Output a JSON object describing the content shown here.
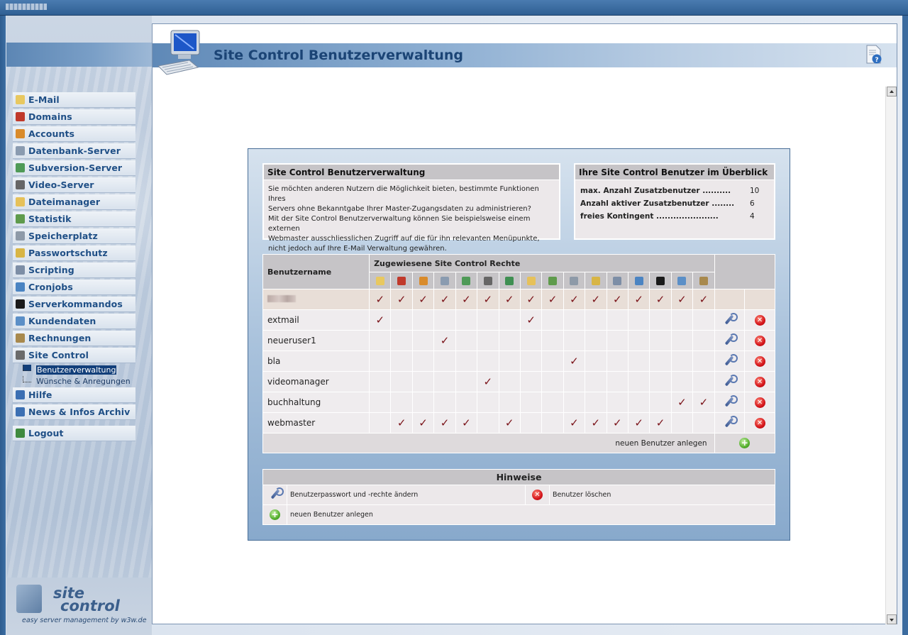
{
  "sidebar": {
    "items": [
      {
        "label": "E-Mail",
        "icon": "mail-icon",
        "color": "#e8c860"
      },
      {
        "label": "Domains",
        "icon": "domains-icon",
        "color": "#c0392b"
      },
      {
        "label": "Accounts",
        "icon": "accounts-icon",
        "color": "#d98b2b"
      },
      {
        "label": "Datenbank-Server",
        "icon": "database-icon",
        "color": "#8a9bb0"
      },
      {
        "label": "Subversion-Server",
        "icon": "subversion-icon",
        "color": "#4f9a57"
      },
      {
        "label": "Video-Server",
        "icon": "video-icon",
        "color": "#666666"
      },
      {
        "label": "Dateimanager",
        "icon": "folder-icon",
        "color": "#e6c15a"
      },
      {
        "label": "Statistik",
        "icon": "statistics-icon",
        "color": "#5f9b4c"
      },
      {
        "label": "Speicherplatz",
        "icon": "disk-icon",
        "color": "#8e9aa8"
      },
      {
        "label": "Passwortschutz",
        "icon": "lock-icon",
        "color": "#d8b545"
      },
      {
        "label": "Scripting",
        "icon": "script-icon",
        "color": "#7d8ea6"
      },
      {
        "label": "Cronjobs",
        "icon": "clock-icon",
        "color": "#4b84c2"
      },
      {
        "label": "Serverkommandos",
        "icon": "terminal-icon",
        "color": "#1a1a1a"
      },
      {
        "label": "Kundendaten",
        "icon": "customer-icon",
        "color": "#5b8fc7"
      },
      {
        "label": "Rechnungen",
        "icon": "invoice-icon",
        "color": "#a8894d"
      },
      {
        "label": "Site Control",
        "icon": "site-control-icon",
        "color": "#6b6b6b"
      }
    ],
    "subitems": [
      {
        "label": "Benutzerverwaltung",
        "active": true
      },
      {
        "label": "Wünsche & Anregungen",
        "active": false
      }
    ],
    "items_after": [
      {
        "label": "Hilfe",
        "icon": "help-icon",
        "color": "#3b6fb3"
      },
      {
        "label": "News & Infos Archiv",
        "icon": "info-icon",
        "color": "#3b6fb3"
      }
    ],
    "logout": {
      "label": "Logout",
      "icon": "logout-icon",
      "color": "#3f8a3f"
    },
    "brand": {
      "line1": "site",
      "line2": "control",
      "tagline": "easy server management by w3w.de"
    }
  },
  "header": {
    "title": "Site Control Benutzerverwaltung"
  },
  "info": {
    "title": "Site Control Benutzerverwaltung",
    "lines": [
      "Sie möchten anderen Nutzern die Möglichkeit bieten, bestimmte Funktionen Ihres",
      "Servers ohne Bekanntgabe Ihrer Master-Zugangsdaten zu administrieren?",
      "Mit der Site Control Benutzerverwaltung können Sie beispielsweise einem externen",
      "Webmaster ausschliesslichen Zugriff auf die für ihn relevanten Menüpunkte,",
      "nicht jedoch auf Ihre E-Mail Verwaltung gewähren."
    ]
  },
  "stats": {
    "title": "Ihre Site Control Benutzer im Überblick",
    "rows": [
      {
        "label": "max. Anzahl Zusatzbenutzer ..........",
        "value": "10"
      },
      {
        "label": "Anzahl aktiver Zusatzbenutzer ........",
        "value": "6"
      },
      {
        "label": "freies Kontingent ......................",
        "value": "4"
      }
    ]
  },
  "table": {
    "col_username": "Benutzername",
    "col_rights": "Zugewiesene Site Control Rechte",
    "right_icons": [
      {
        "name": "mail-icon",
        "color": "#e8c860"
      },
      {
        "name": "domains-icon",
        "color": "#c0392b"
      },
      {
        "name": "accounts-icon",
        "color": "#d98b2b"
      },
      {
        "name": "database-icon",
        "color": "#8a9bb0"
      },
      {
        "name": "subversion-icon",
        "color": "#4f9a57"
      },
      {
        "name": "video-icon",
        "color": "#666666"
      },
      {
        "name": "globe-icon",
        "color": "#3f8f52"
      },
      {
        "name": "folder-icon",
        "color": "#e6c15a"
      },
      {
        "name": "statistics-icon",
        "color": "#5f9b4c"
      },
      {
        "name": "disk-icon",
        "color": "#8e9aa8"
      },
      {
        "name": "lock-icon",
        "color": "#d8b545"
      },
      {
        "name": "script-icon",
        "color": "#7d8ea6"
      },
      {
        "name": "clock-icon",
        "color": "#4b84c2"
      },
      {
        "name": "terminal-icon",
        "color": "#1a1a1a"
      },
      {
        "name": "customer-icon",
        "color": "#5b8fc7"
      },
      {
        "name": "invoice-icon",
        "color": "#a8894d"
      }
    ],
    "master_checks": [
      1,
      1,
      1,
      1,
      1,
      1,
      1,
      1,
      1,
      1,
      1,
      1,
      1,
      1,
      1,
      1
    ],
    "users": [
      {
        "name": "extmail",
        "checks": [
          1,
          0,
          0,
          0,
          0,
          0,
          0,
          1,
          0,
          0,
          0,
          0,
          0,
          0,
          0,
          0
        ]
      },
      {
        "name": "neueruser1",
        "checks": [
          0,
          0,
          0,
          1,
          0,
          0,
          0,
          0,
          0,
          0,
          0,
          0,
          0,
          0,
          0,
          0
        ]
      },
      {
        "name": "bla",
        "checks": [
          0,
          0,
          0,
          0,
          0,
          0,
          0,
          0,
          0,
          1,
          0,
          0,
          0,
          0,
          0,
          0
        ]
      },
      {
        "name": "videomanager",
        "checks": [
          0,
          0,
          0,
          0,
          0,
          1,
          0,
          0,
          0,
          0,
          0,
          0,
          0,
          0,
          0,
          0
        ]
      },
      {
        "name": "buchhaltung",
        "checks": [
          0,
          0,
          0,
          0,
          0,
          0,
          0,
          0,
          0,
          0,
          0,
          0,
          0,
          0,
          1,
          1
        ]
      },
      {
        "name": "webmaster",
        "checks": [
          0,
          1,
          1,
          1,
          1,
          0,
          1,
          0,
          0,
          1,
          1,
          1,
          1,
          1,
          0,
          0
        ]
      }
    ],
    "new_user_label": "neuen Benutzer anlegen",
    "check_glyph": "✓"
  },
  "legend": {
    "title": "Hinweise",
    "edit_text": "Benutzerpasswort und -rechte ändern",
    "delete_text": "Benutzer löschen",
    "add_text": "neuen Benutzer anlegen"
  },
  "colors": {
    "accent": "#1b4475",
    "check": "#7a1218"
  }
}
